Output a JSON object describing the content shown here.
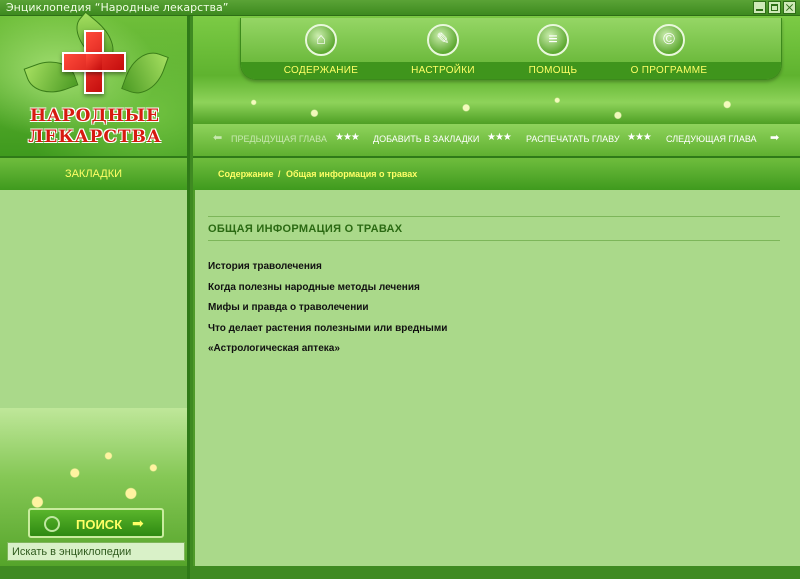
{
  "window": {
    "title": "Энциклопедия “Народные лекарства”"
  },
  "logo": {
    "line1": "НАРОДНЫЕ",
    "line2": "ЛЕКАРСТВА"
  },
  "main_menu": [
    {
      "label": "СОДЕРЖАНИЕ",
      "icon": "home-icon"
    },
    {
      "label": "НАСТРОЙКИ",
      "icon": "wrench-icon"
    },
    {
      "label": "ПОМОЩЬ",
      "icon": "book-icon"
    },
    {
      "label": "О ПРОГРАММЕ",
      "icon": "copyright-icon"
    }
  ],
  "chapter_nav": {
    "prev": "ПРЕДЫДУЩАЯ ГЛАВА",
    "bookmark": "ДОБАВИТЬ В ЗАКЛАДКИ",
    "print": "РАСПЕЧАТАТЬ ГЛАВУ",
    "next": "СЛЕДУЮЩАЯ ГЛАВА",
    "stars": "★★★"
  },
  "sidebar": {
    "bookmarks_title": "ЗАКЛАДКИ",
    "search_button": "ПОИСК",
    "search_placeholder": "Искать в энциклопедии"
  },
  "breadcrumb": {
    "home": "Содержание",
    "separator": "/",
    "current": "Общая информация о травах"
  },
  "content": {
    "heading": "ОБЩАЯ ИНФОРМАЦИЯ О ТРАВАХ",
    "items": [
      "История траволечения",
      "Когда полезны народные методы лечения",
      "Мифы и правда о траволечении",
      "Что делает растения полезными или вредными",
      "«Астрологическая аптека»"
    ]
  },
  "colors": {
    "accent_yellow": "#ffff66",
    "panel_green": "#aad98a",
    "dark_green": "#2f7a18",
    "logo_red": "#d61b10"
  }
}
